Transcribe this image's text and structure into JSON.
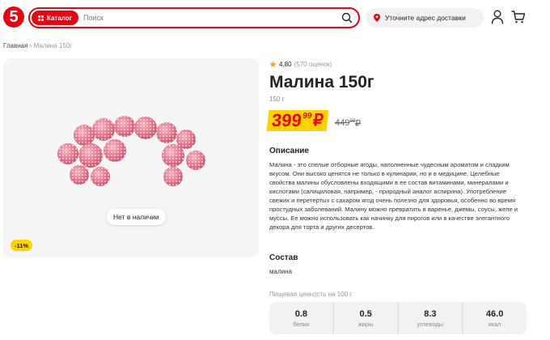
{
  "header": {
    "logo_text": "5",
    "catalog_label": "Каталог",
    "search_placeholder": "Поиск",
    "address_label": "Уточните адрес доставки",
    "brand_color": "#e30613"
  },
  "breadcrumb": {
    "home": "Главная",
    "separator": "›",
    "current": "Малина 150г"
  },
  "product": {
    "rating": "4,80",
    "rating_count": "(570 оценок)",
    "title": "Малина 150г",
    "weight": "150 г",
    "price_rub": "399",
    "price_kop": "99",
    "currency": "₽",
    "old_price_rub": "449",
    "old_price_kop": "99",
    "discount": "-11%",
    "stock_status": "Нет в наличии",
    "description_heading": "Описание",
    "description": "Малина - это спелые отборные ягоды, наполненные чудесным ароматом и сладким вкусом. Они высоко ценятся не только в кулинарии, но и в медицине. Целебные свойства малины обусловлены входящими в ее состав витаминами, минералами и кислотами (салициловая, например, - природный аналог аспирина). Употребление свежих и перетертых с сахаром ягод очень полезно для здоровья, особенно во время простудных заболеваний. Малину можно превратить в варенье, джемы, соусы, желе и муссы. Ее можно использовать как начинку для пирогов или в качестве элегантного декора для торта и других десертов.",
    "composition_heading": "Состав",
    "composition": "малина",
    "nutrition_heading": "Пищевая ценность на 100 г",
    "nutrition": [
      {
        "value": "0.8",
        "label": "белки"
      },
      {
        "value": "0.5",
        "label": "жиры"
      },
      {
        "value": "8.3",
        "label": "углеводы"
      },
      {
        "value": "46.0",
        "label": "ккал"
      }
    ]
  }
}
